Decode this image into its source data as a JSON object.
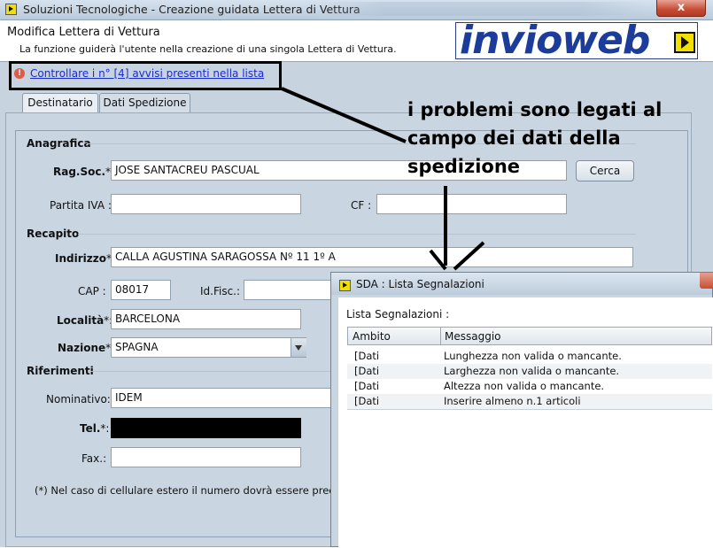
{
  "window": {
    "title": "Soluzioni Tecnologiche - Creazione guidata Lettera di Vettura",
    "close_symbol": "x"
  },
  "header": {
    "title": "Modifica Lettera di Vettura",
    "subtitle": "La funzione guiderà l'utente nella creazione di una singola Lettera di Vettura.",
    "logo_text": "invioweb"
  },
  "warning": {
    "link_text": "Controllare i n° [4] avvisi presenti nella lista",
    "icon": "warning-icon"
  },
  "annotation": {
    "text": "i problemi sono legati al campo dei dati della spedizione"
  },
  "tabs": [
    {
      "label": "Destinatario"
    },
    {
      "label": "Dati Spedizione"
    }
  ],
  "form": {
    "anagrafica": "Anagrafica",
    "ragsoc_label": "Rag.Soc.",
    "ragsoc_value": "JOSE SANTACREU PASCUAL",
    "cerca": "Cerca",
    "piva_label": "Partita IVA :",
    "cf_label": "CF :",
    "recapito": "Recapito",
    "indirizzo_label": "Indirizzo",
    "indirizzo_value": "CALLA AGUSTINA SARAGOSSA Nº 11 1º A",
    "cap_label": "CAP :",
    "cap_value": "08017",
    "idfisc_label": "Id.Fisc.:",
    "localita_label": "Località",
    "localita_value": "BARCELONA",
    "nazione_label": "Nazione",
    "nazione_value": "SPAGNA",
    "riferimenti": "Riferimenti",
    "nominativo_label": "Nominativo:",
    "nominativo_value": "IDEM",
    "tel_label": "Tel.",
    "fax_label": "Fax.:",
    "note": "(*) Nel caso di cellulare estero il numero dovrà essere preced",
    "req_mark": "*:"
  },
  "popup": {
    "title": "SDA : Lista Segnalazioni",
    "list_label": "Lista Segnalazioni :",
    "col_ambito": "Ambito",
    "col_messaggio": "Messaggio",
    "rows": [
      {
        "ambito": "[Dati",
        "messaggio": "Lunghezza non valida o mancante."
      },
      {
        "ambito": "[Dati",
        "messaggio": "Larghezza non valida o mancante."
      },
      {
        "ambito": "[Dati",
        "messaggio": "Altezza non valida o mancante."
      },
      {
        "ambito": "[Dati",
        "messaggio": "Inserire almeno n.1 articoli"
      }
    ]
  },
  "colors": {
    "accent": "#1c3c9c",
    "link": "#1a2bd0",
    "close": "#c74b34"
  }
}
